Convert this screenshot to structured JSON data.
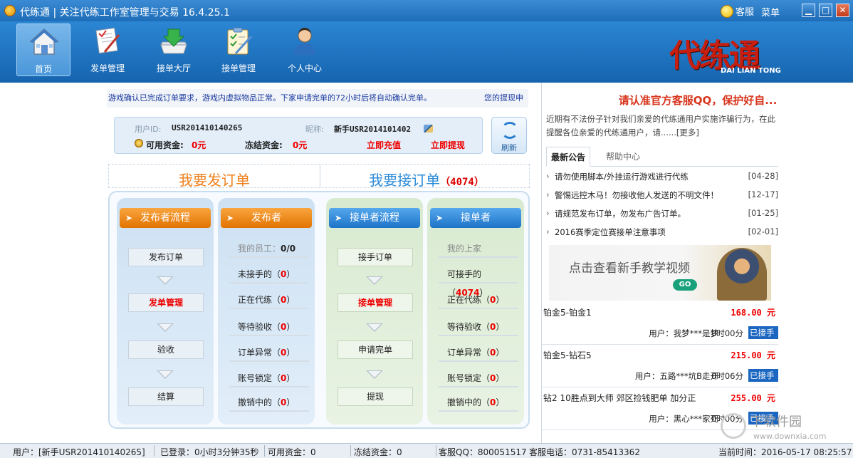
{
  "window": {
    "title": "代练通 | 关注代练工作室管理与交易 16.4.25.1",
    "service": "客服",
    "menu": "菜单",
    "min": "▁",
    "max": "□",
    "close": "✕"
  },
  "toolbar": {
    "items": [
      {
        "label": "首页",
        "icon": "home-icon",
        "active": true
      },
      {
        "label": "发单管理",
        "icon": "publish-icon"
      },
      {
        "label": "接单大厅",
        "icon": "accept-hall-icon"
      },
      {
        "label": "接单管理",
        "icon": "accept-manage-icon"
      },
      {
        "label": "个人中心",
        "icon": "user-center-icon"
      }
    ],
    "brand_title": "代练通",
    "brand_sub": "DAI LIAN TONG"
  },
  "notice": {
    "text": "游戏确认已完成订单要求，游戏内虚拟物品正常。下家申请完单的72小时后将自动确认完单。",
    "link": "您的提现申"
  },
  "user": {
    "id_label": "用户ID:",
    "id": "USR201410140265",
    "nick_label": "昵称:",
    "nick": "新手USR2014101402",
    "avail_label": "可用资金:",
    "avail": "0元",
    "frozen_label": "冻结资金:",
    "frozen": "0元",
    "recharge": "立即充值",
    "withdraw": "立即提现",
    "refresh": "刷新"
  },
  "headers": {
    "publish": "我要发订单",
    "accept": "我要接订单",
    "accept_count": "（4074）"
  },
  "publisher_flow": {
    "title": "发布者流程",
    "steps": [
      "发布订单",
      "发单管理",
      "验收",
      "结算"
    ]
  },
  "publisher": {
    "title": "发布者",
    "staff_label": "我的员工：",
    "staff_value": "0/0",
    "rows": [
      {
        "label": "未接手的",
        "value": "0"
      },
      {
        "label": "正在代练",
        "value": "0"
      },
      {
        "label": "等待验收",
        "value": "0"
      },
      {
        "label": "订单异常",
        "value": "0"
      },
      {
        "label": "账号锁定",
        "value": "0"
      },
      {
        "label": "撤销中的",
        "value": "0"
      }
    ]
  },
  "acceptor_flow": {
    "title": "接单者流程",
    "steps": [
      "接手订单",
      "接单管理",
      "申请完单",
      "提现"
    ]
  },
  "acceptor": {
    "title": "接单者",
    "upper_label": "我的上家",
    "rows": [
      {
        "label": "可接手的",
        "value": "4074"
      },
      {
        "label": "正在代练",
        "value": "0"
      },
      {
        "label": "等待验收",
        "value": "0"
      },
      {
        "label": "订单异常",
        "value": "0"
      },
      {
        "label": "账号锁定",
        "value": "0"
      },
      {
        "label": "撤销中的",
        "value": "0"
      }
    ]
  },
  "right": {
    "warn_title": "请认准官方客服QQ，保护好自...",
    "warn_text": "近期有不法份子针对我们亲爱的代练通用户实施诈骗行为，在此提醒各位亲爱的代练通用户，请......[更多]",
    "tab_active": "最新公告",
    "tab_inactive": "帮助中心",
    "news": [
      {
        "text": "请勿使用脚本/外挂运行游戏进行代练",
        "date": "[04-28]"
      },
      {
        "text": "警惕远控木马！勿接收他人发送的不明文件！",
        "date": "[12-17]"
      },
      {
        "text": "请规范发布订单，勿发布广告订单。",
        "date": "[01-25]"
      },
      {
        "text": "2016赛季定位赛接单注意事项",
        "date": "[02-01]"
      }
    ],
    "banner_text": "点击查看新手教学视频",
    "banner_go": "GO",
    "orders": [
      {
        "title": "铂金5-铂金1",
        "price": "168.00 元",
        "user": "用户：我梦***是梦",
        "time": "0时00分",
        "status": "已接手"
      },
      {
        "title": "铂金5-钻石5",
        "price": "215.00 元",
        "user": "用户：五路***坑B走开",
        "time": "0时06分",
        "status": "已接手"
      },
      {
        "title": "钻2 10胜点到大师 郊区捡钱肥单 加分正",
        "price": "255.00 元",
        "user": "用户：黑心***家死",
        "time": "0时00分",
        "status": "已接手"
      }
    ],
    "watermark": "下软件园",
    "watermark_url": "www.downxia.com"
  },
  "statusbar": {
    "user": "用户：[新手USR201410140265]",
    "logged": "已登录：0小时3分钟35秒",
    "avail": "可用资金：0",
    "frozen": "冻结资金：0",
    "qq": "客服QQ：800051517",
    "phone": "客服电话：0731-85413362",
    "time": "当前时间：2016-05-17 08:25:57"
  }
}
